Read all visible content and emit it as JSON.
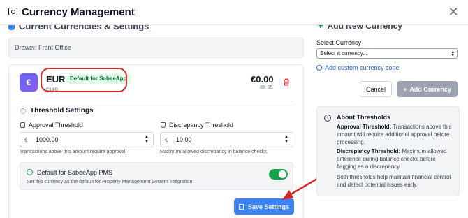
{
  "header": {
    "title": "Currency Management"
  },
  "left": {
    "section_title": "Current Currencies & Settings",
    "drawer": "Drawer: Front Office",
    "currency": {
      "symbol": "€",
      "code": "EUR",
      "default_badge": "Default for SabeeApp",
      "name": "Euro",
      "amount": "€0.00",
      "id": "ID: 35"
    },
    "threshold": {
      "title": "Threshold Settings",
      "approval_label": "Approval Threshold",
      "approval_symbol": "€",
      "approval_value": "1000.00",
      "approval_help": "Transactions above this amount require approval",
      "discrepancy_label": "Discrepancy Threshold",
      "discrepancy_symbol": "€",
      "discrepancy_value": "10.00",
      "discrepancy_help": "Maximum allowed discrepancy in balance checks"
    },
    "pms": {
      "title": "Default for SabeeApp PMS",
      "description": "Set this currency as the default for Property Management System integration",
      "enabled": true
    },
    "save_label": "Save Settings"
  },
  "right": {
    "section_title": "Add New Currency",
    "select_label": "Select Currency",
    "select_value": "Select a currency...",
    "custom_link": "Add custom currency code",
    "cancel_label": "Cancel",
    "add_label": "Add Currency",
    "about": {
      "title": "About Thresholds",
      "approval_term": "Approval Threshold:",
      "approval_text": "Transactions above this amount will require additional approval before processing.",
      "discrepancy_term": "Discrepancy Threshold:",
      "discrepancy_text": "Maximum allowed difference during balance checks before flagging as a discrepancy.",
      "footer": "Both thresholds help maintain financial control and detect potential issues early."
    }
  },
  "colors": {
    "accent": "#3b82f6",
    "highlight": "#dc2626",
    "success": "#16a34a"
  }
}
